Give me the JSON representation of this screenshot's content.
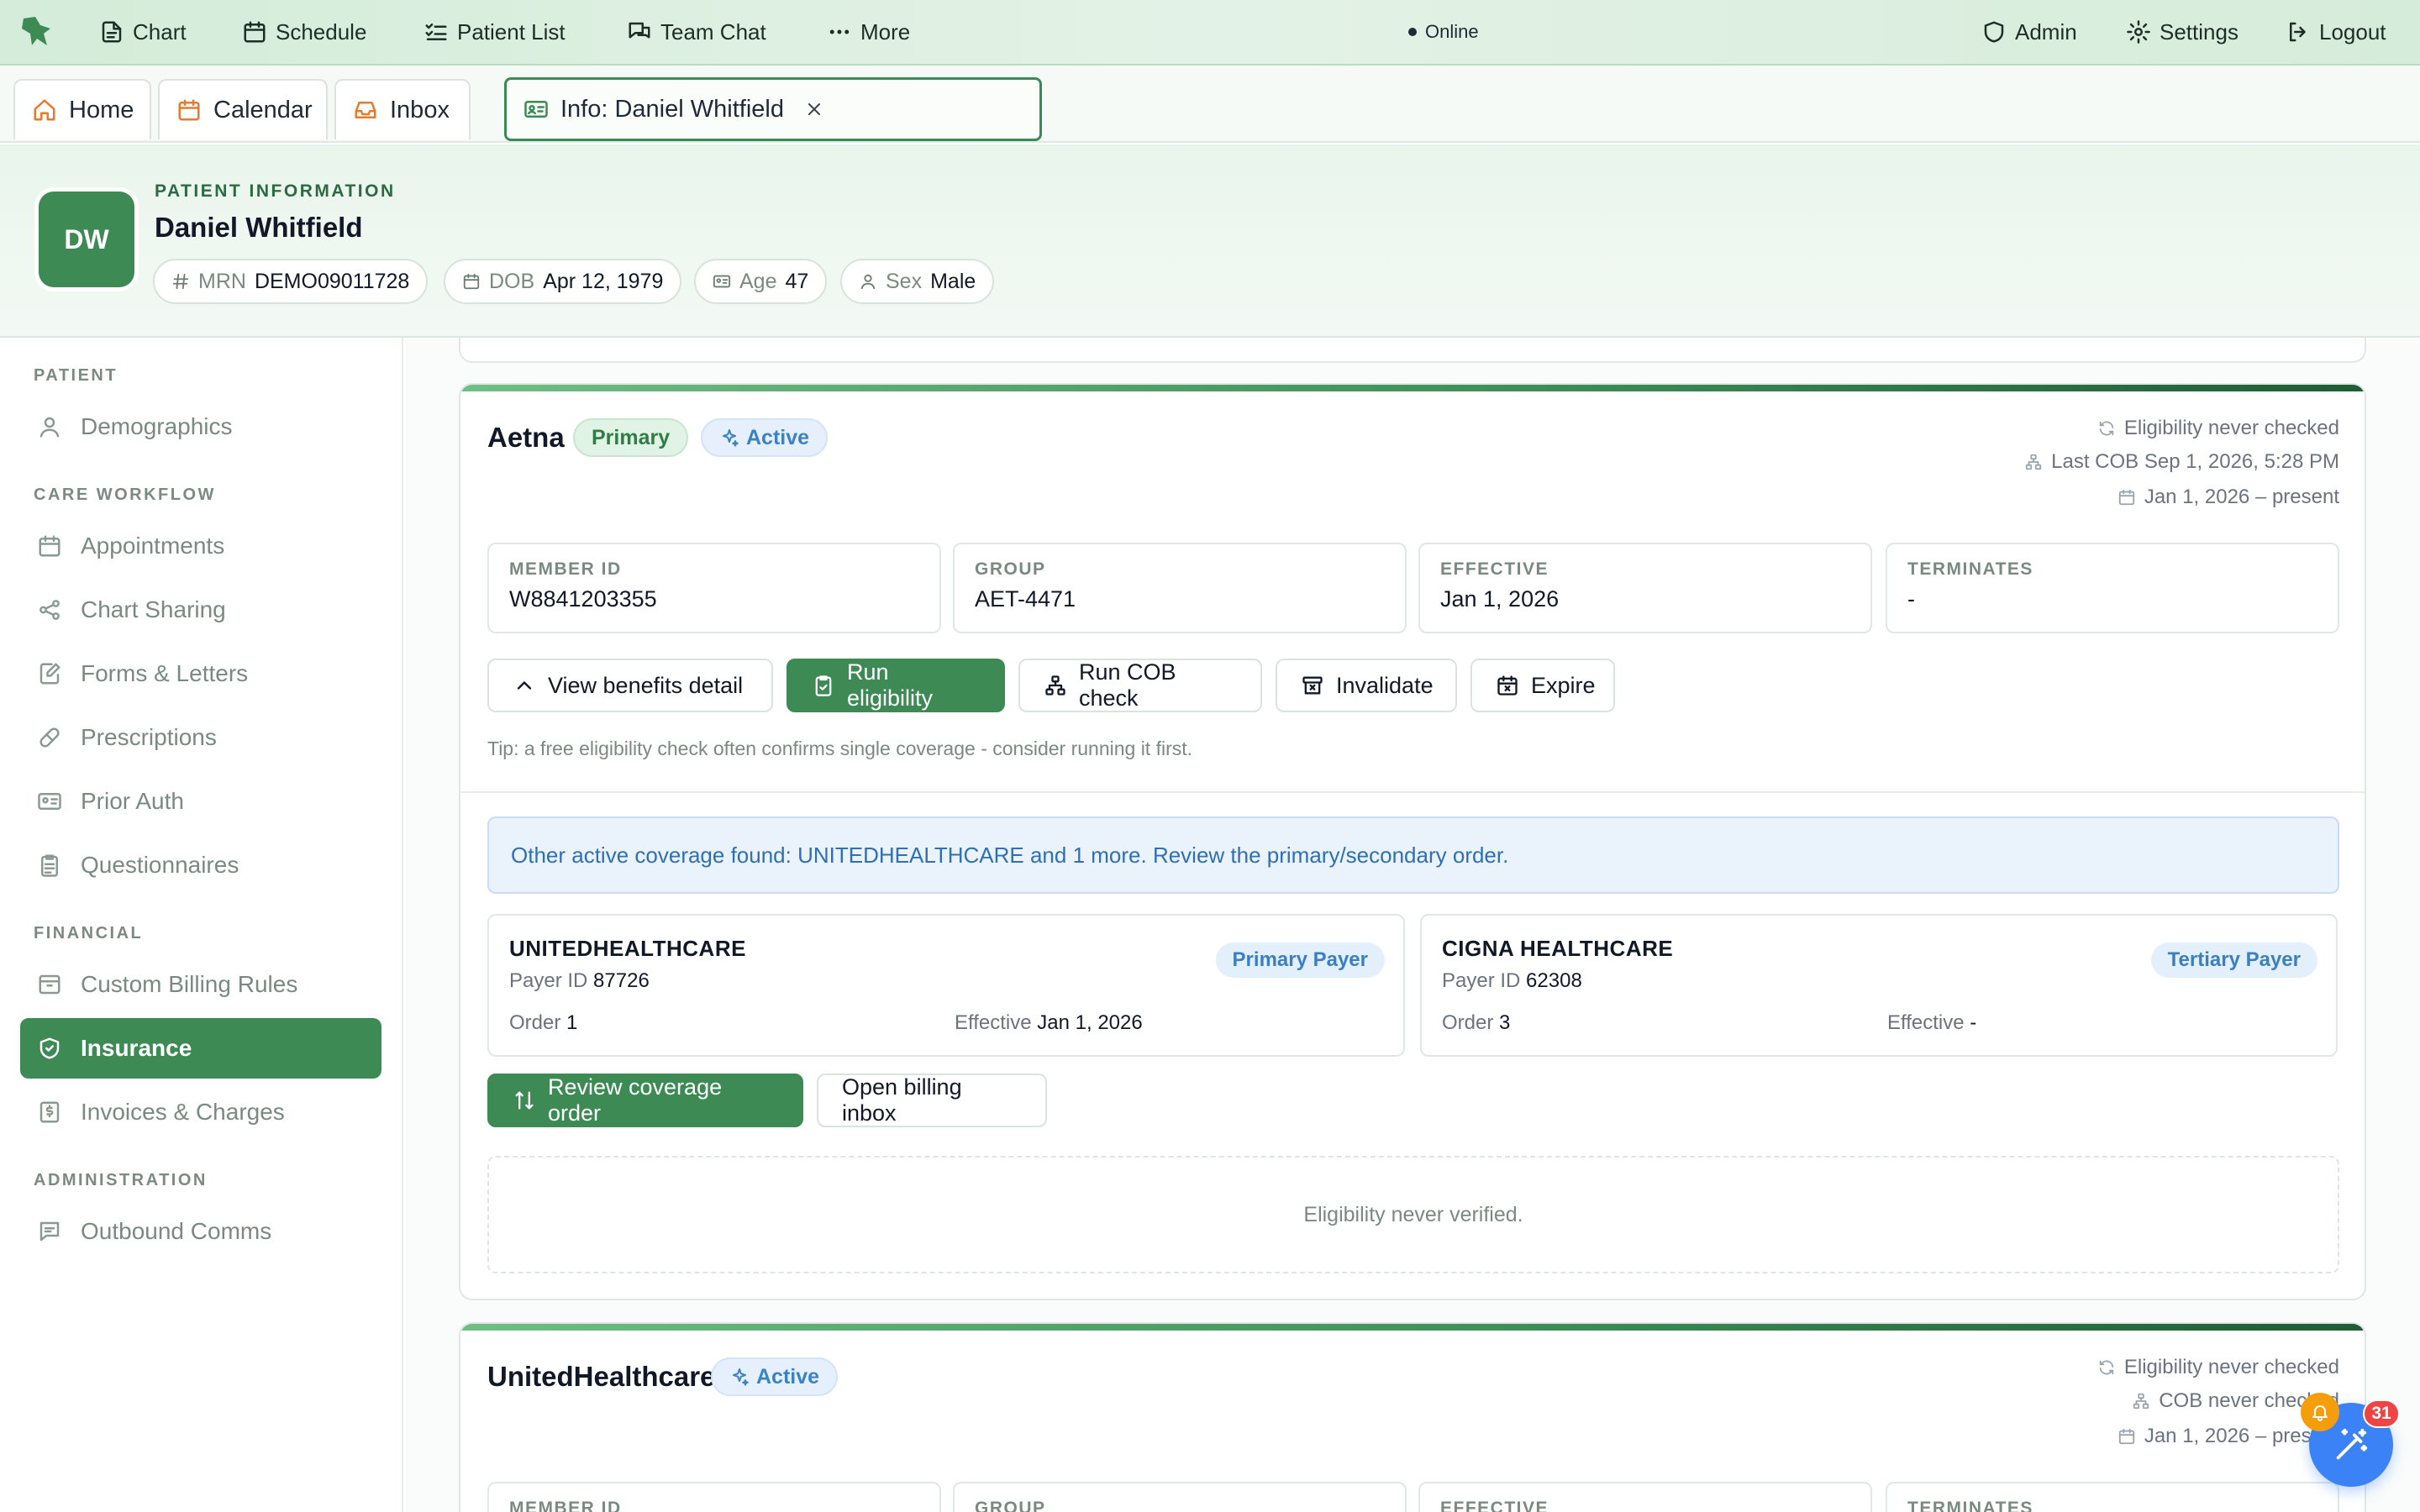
{
  "topnav": {
    "items": [
      {
        "label": "Chart",
        "icon": "file-text-icon"
      },
      {
        "label": "Schedule",
        "icon": "calendar-icon"
      },
      {
        "label": "Patient List",
        "icon": "list-check-icon"
      },
      {
        "label": "Team Chat",
        "icon": "chat-icon"
      },
      {
        "label": "More",
        "icon": "more-dots-icon"
      }
    ],
    "status": "Online",
    "right": [
      {
        "label": "Admin",
        "icon": "shield-icon"
      },
      {
        "label": "Settings",
        "icon": "gear-icon"
      },
      {
        "label": "Logout",
        "icon": "logout-icon"
      }
    ]
  },
  "tabs": [
    {
      "label": "Home",
      "icon": "home-icon"
    },
    {
      "label": "Calendar",
      "icon": "calendar-icon"
    },
    {
      "label": "Inbox",
      "icon": "inbox-icon"
    },
    {
      "label": "Info: Daniel Whitfield",
      "icon": "id-card-icon",
      "active": true
    }
  ],
  "patient": {
    "section_label": "PATIENT INFORMATION",
    "name": "Daniel Whitfield",
    "initials": "DW",
    "mrn_label": "MRN",
    "mrn": "DEMO09011728",
    "dob_label": "DOB",
    "dob": "Apr 12, 1979",
    "age_label": "Age",
    "age": "47",
    "sex_label": "Sex",
    "sex": "Male"
  },
  "sidebar": {
    "sections": [
      {
        "header": "PATIENT",
        "items": [
          {
            "label": "Demographics",
            "icon": "user-icon"
          }
        ]
      },
      {
        "header": "CARE WORKFLOW",
        "items": [
          {
            "label": "Appointments",
            "icon": "calendar-icon"
          },
          {
            "label": "Chart Sharing",
            "icon": "share-icon"
          },
          {
            "label": "Forms & Letters",
            "icon": "edit-document-icon"
          },
          {
            "label": "Prescriptions",
            "icon": "pill-icon"
          },
          {
            "label": "Prior Auth",
            "icon": "id-card-icon"
          },
          {
            "label": "Questionnaires",
            "icon": "clipboard-icon"
          }
        ]
      },
      {
        "header": "FINANCIAL",
        "items": [
          {
            "label": "Custom Billing Rules",
            "icon": "archive-icon"
          },
          {
            "label": "Insurance",
            "icon": "shield-check-icon",
            "active": true
          },
          {
            "label": "Invoices & Charges",
            "icon": "dollar-document-icon"
          }
        ]
      },
      {
        "header": "ADMINISTRATION",
        "items": [
          {
            "label": "Outbound Comms",
            "icon": "message-icon"
          }
        ]
      }
    ]
  },
  "policy1": {
    "payer": "Aetna",
    "badge_primary": "Primary",
    "badge_active": "Active",
    "eligibility_status": "Eligibility never checked",
    "last_cob": "Last COB Sep 1, 2026, 5:28 PM",
    "coverage_period": "Jan 1, 2026 – present",
    "fields": [
      {
        "label": "MEMBER ID",
        "value": "W8841203355"
      },
      {
        "label": "GROUP",
        "value": "AET-4471"
      },
      {
        "label": "EFFECTIVE",
        "value": "Jan 1, 2026"
      },
      {
        "label": "TERMINATES",
        "value": "-"
      }
    ],
    "buttons": {
      "benefits": "View benefits detail",
      "eligibility": "Run eligibility",
      "cob": "Run COB check",
      "invalidate": "Invalidate",
      "expire": "Expire"
    },
    "tip": "Tip: a free eligibility check often confirms single coverage - consider running it first.",
    "cob_alert": "Other active coverage found: UNITEDHEALTHCARE and 1 more. Review the primary/secondary order.",
    "other_payers": [
      {
        "name": "UNITEDHEALTHCARE",
        "payer_id_label": "Payer ID",
        "payer_id": "87726",
        "order_label": "Order",
        "order": "1",
        "effective_label": "Effective",
        "effective": "Jan 1, 2026",
        "tag": "Primary Payer"
      },
      {
        "name": "CIGNA HEALTHCARE",
        "payer_id_label": "Payer ID",
        "payer_id": "62308",
        "order_label": "Order",
        "order": "3",
        "effective_label": "Effective",
        "effective": "-",
        "tag": "Tertiary Payer"
      }
    ],
    "review_button": "Review coverage order",
    "billing_button": "Open billing inbox",
    "eligibility_note": "Eligibility never verified."
  },
  "policy2": {
    "payer": "UnitedHealthcare",
    "badge_active": "Active",
    "eligibility_status": "Eligibility never checked",
    "cob_status": "COB never checked",
    "coverage_period": "Jan 1, 2026 – present",
    "fields": [
      {
        "label": "MEMBER ID"
      },
      {
        "label": "GROUP"
      },
      {
        "label": "EFFECTIVE"
      },
      {
        "label": "TERMINATES"
      }
    ]
  },
  "widget": {
    "count": "31",
    "icon": "magic-wand-icon",
    "bell_icon": "bell-icon"
  },
  "colors": {
    "brand": "#3d8a55",
    "accent_orange": "#ea7a2b",
    "info_blue": "#3b82c4",
    "alert_red": "#ef4444"
  }
}
